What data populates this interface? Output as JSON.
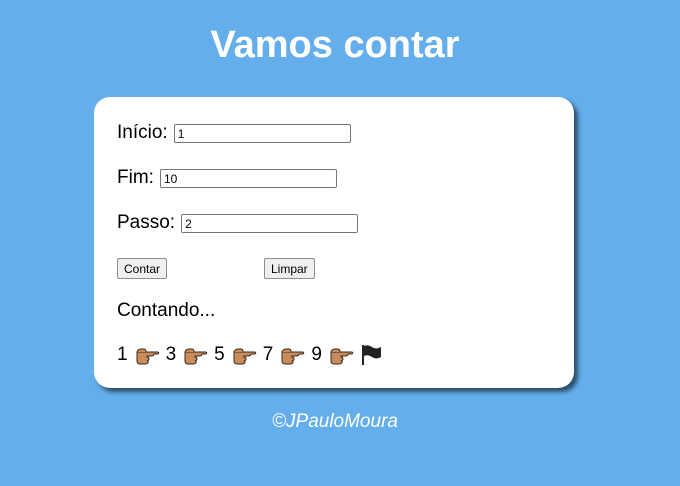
{
  "page_title": "Vamos contar",
  "form": {
    "inicio_label": "Início:",
    "inicio_value": "1",
    "fim_label": "Fim:",
    "fim_value": "10",
    "passo_label": "Passo:",
    "passo_value": "2"
  },
  "buttons": {
    "contar": "Contar",
    "limpar": "Limpar"
  },
  "status_text": "Contando...",
  "sequence": {
    "numbers": [
      "1",
      "3",
      "5",
      "7",
      "9"
    ],
    "separator_icon": "pointing-hand-icon",
    "end_icon": "black-flag-icon"
  },
  "footer": "©JPauloMoura",
  "colors": {
    "background": "#63aeeb",
    "card": "#ffffff",
    "hand": "#c98b5a"
  }
}
